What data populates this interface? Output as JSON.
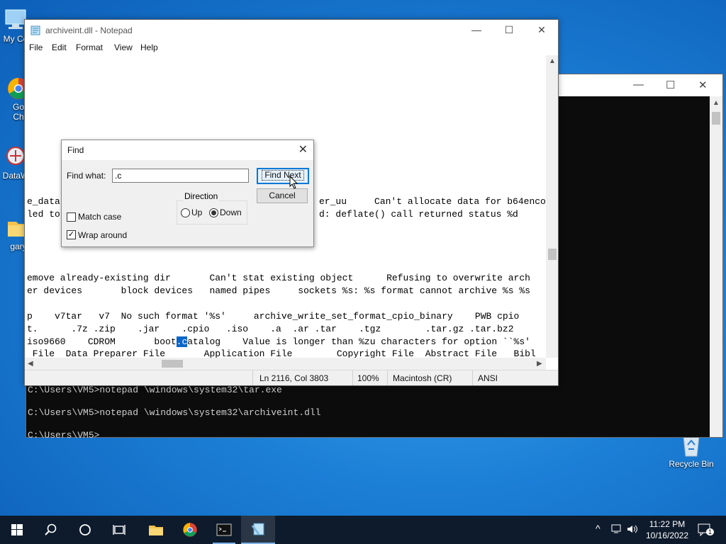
{
  "desktop": {
    "icons": [
      {
        "label": "My Co",
        "icon": "computer-icon"
      },
      {
        "label": "Go\nCh",
        "icon": "chrome-icon"
      },
      {
        "label": "DataW",
        "icon": "app-icon"
      },
      {
        "label": "gary",
        "icon": "folder-icon"
      },
      {
        "label": "Recycle Bin",
        "icon": "recycle-bin-icon"
      }
    ]
  },
  "console": {
    "lines": [
      "C:\\Users\\VM5>notepad \\windows\\system32\\tar.exe",
      "C:\\Users\\VM5>notepad \\windows\\system32\\archiveint.dll",
      "C:\\Users\\VM5>"
    ],
    "controls": {
      "minimize": "—",
      "maximize": "☐",
      "close": "✕"
    }
  },
  "notepad": {
    "title": "archiveint.dll - Notepad",
    "controls": {
      "minimize": "—",
      "maximize": "☐",
      "close": "✕"
    },
    "menu": [
      "File",
      "Edit",
      "Format",
      "View",
      "Help"
    ],
    "text_lines": [
      "e_data",
      "led to",
      "emove already-existing dir       Can't stat existing object      Refusing to overwrite arch",
      "er devices       block devices   named pipes     sockets %s: %s format cannot archive %s %s",
      "p    v7tar   v7  No such format '%s'     archive_write_set_format_cpio_binary    PWB cpio",
      "t.      .7z .zip    .jar    .cpio   .iso    .a  .ar .tar    .tgz        .tar.gz .tar.bz2",
      " File  Data Preparer File       Application File        Copyright File  Abstract File   Bibl"
    ],
    "partial_right_1": "er_uu     Can't allocate data for b64enco",
    "partial_right_2": "d: deflate() call returned status %d",
    "match_line": {
      "before": "iso9660    CDROM       boot",
      "selected": ".c",
      "after": "atalog    Value is longer than %zu characters for option ``%s'"
    },
    "status": {
      "position": "Ln 2116, Col 3803",
      "zoom": "100%",
      "line_ending": "Macintosh (CR)",
      "encoding": "ANSI"
    }
  },
  "find_dialog": {
    "title": "Find",
    "find_what_label": "Find what:",
    "find_what_value": ".c",
    "find_next_label": "Find Next",
    "cancel_label": "Cancel",
    "direction_label": "Direction",
    "up_label": "Up",
    "down_label": "Down",
    "direction_selected": "Down",
    "match_case_label": "Match case",
    "match_case_checked": false,
    "wrap_around_label": "Wrap around",
    "wrap_around_checked": true
  },
  "taskbar": {
    "items": [
      "start-icon",
      "search-icon",
      "task-view-icon",
      "multitasking-icon",
      "file-explorer-icon",
      "chrome-icon",
      "terminal-icon",
      "notepad-icon"
    ],
    "time": "11:22 PM",
    "date": "10/16/2022",
    "notification_count": "1"
  },
  "colors": {
    "selection": "#0a66c8",
    "accent": "#0078d7",
    "taskbar": "#0e1b2c"
  }
}
